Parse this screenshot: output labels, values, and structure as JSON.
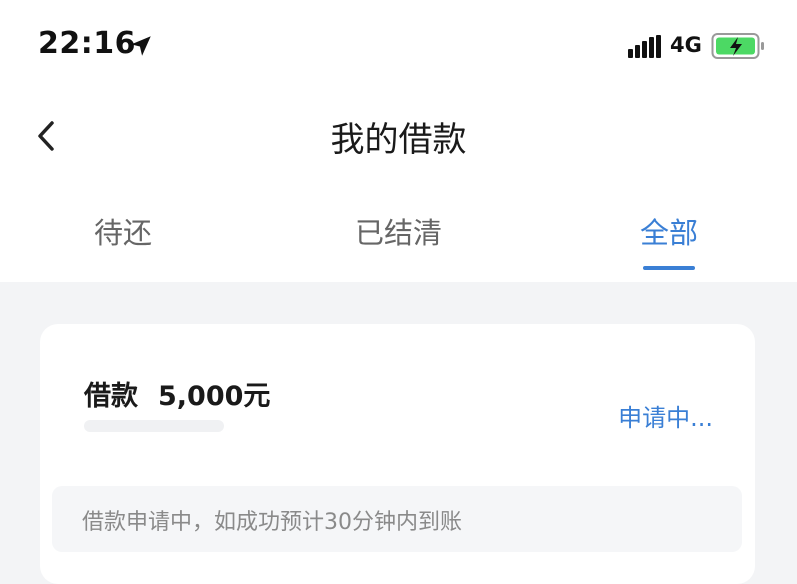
{
  "status_bar": {
    "time": "22:16",
    "network": "4G",
    "icons": [
      "location-arrow-icon",
      "signal-icon",
      "battery-charging-icon"
    ]
  },
  "nav": {
    "title": "我的借款",
    "back_icon": "chevron-left-icon"
  },
  "tabs": [
    {
      "label": "待还",
      "active": false
    },
    {
      "label": "已结清",
      "active": false
    },
    {
      "label": "全部",
      "active": true
    }
  ],
  "colors": {
    "accent": "#3a7fd5",
    "page_bg": "#f3f4f6",
    "battery_green": "#4cd964"
  },
  "loan": {
    "label": "借款",
    "amount": "5,000元",
    "status": "申请中...",
    "notice": "借款申请中，如成功预计30分钟内到账"
  }
}
